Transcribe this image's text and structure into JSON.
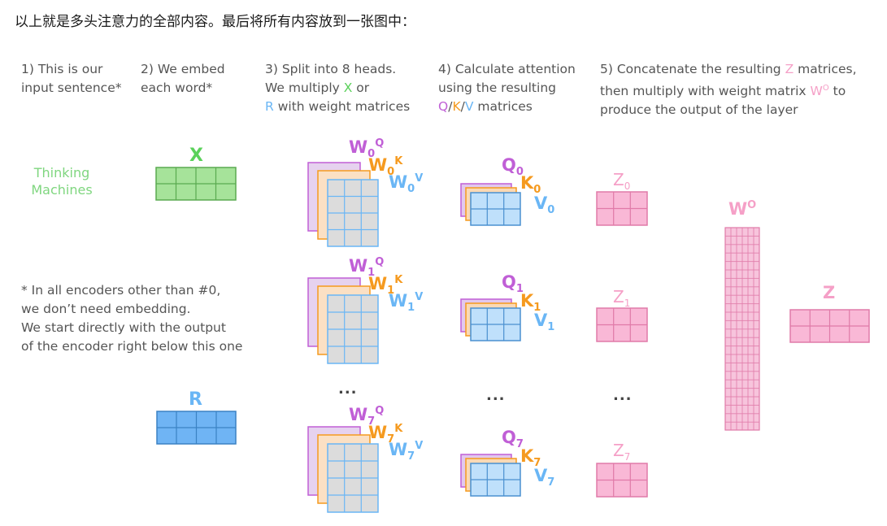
{
  "intro": "以上就是多头注意力的全部内容。最后将所有内容放到一张图中：",
  "steps": {
    "s1": {
      "l1": "1) This is our",
      "l2": "input sentence*"
    },
    "s2": {
      "l1": "2) We embed",
      "l2": "each word*"
    },
    "s3": {
      "l1": "3) Split into 8 heads.",
      "l2a": "We multiply ",
      "l2b": "X",
      "l2c": " or",
      "l3a": "R",
      "l3b": " with weight matrices"
    },
    "s4": {
      "l1": "4) Calculate attention",
      "l2": "using the resulting",
      "l3q": "Q",
      "l3s1": "/",
      "l3k": "K",
      "l3s2": "/",
      "l3v": "V",
      "l3c": " matrices"
    },
    "s5": {
      "l1a": "5) Concatenate the resulting ",
      "l1b": "Z",
      "l1c": " matrices,",
      "l2a": "then multiply with weight matrix ",
      "l2b": "W",
      "l2c": "O",
      "l2d": " to",
      "l3": "produce the output of the layer"
    }
  },
  "input_sentence": {
    "w1": "Thinking",
    "w2": "Machines"
  },
  "note": {
    "l1": "* In all encoders other than #0,",
    "l2": "we don’t need embedding.",
    "l3": "We start directly with the output",
    "l4": "of the encoder right below this one"
  },
  "labels": {
    "x": "X",
    "r": "R",
    "w": "W",
    "q": "Q",
    "k": "K",
    "v": "V",
    "z": "Z",
    "o": "O",
    "head0": "0",
    "head1": "1",
    "head7": "7",
    "ellipsis": "..."
  },
  "colors": {
    "green": "#5bd15b",
    "blue": "#6ab6f5",
    "purple": "#c05fd6",
    "orange": "#f59a1f",
    "pink": "#f5a0c7",
    "text": "#555555"
  }
}
